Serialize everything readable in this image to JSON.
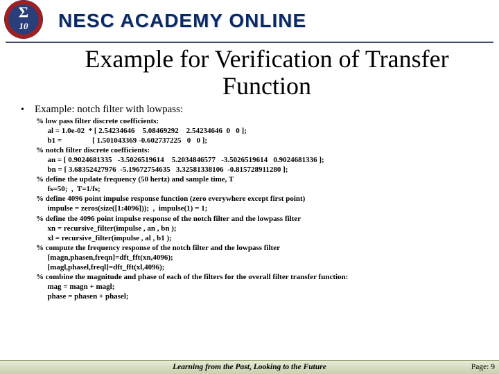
{
  "header": {
    "brand": "NESC ACADEMY ONLINE",
    "logo_sigma": "Σ",
    "logo_ten": "10"
  },
  "title": "Example for Verification of Transfer Function",
  "bullet": "•",
  "example_label": "Example:  notch filter with lowpass:",
  "code_lines": [
    "% low pass filter discrete coefficients:",
    "      al = 1.0e-02  * [ 2.54234646    5.08469292    2.54234646  0   0 ];",
    "      b1 =                [ 1.501043369 -0.602737225   0   0 ];",
    "% notch filter discrete coefficients:",
    "      an = [ 0.9024681335   -3.5026519614    5.2034846577   -3.5026519614   0.9024681336 ];",
    "      bn = [ 3.68352427976  -5.19672754635   3.32581338106  -0.815728911280 ];",
    "% define the update frequency (50 hertz) and sample time, T",
    "      fs=50;  ,  T=1/fs;",
    "% define 4096 point impulse response function (zero everywhere except first point)",
    "      impulse = zeros(size([1:4096]));  ,  impulse(1) = 1;",
    "% define the 4096 point impulse response of the notch filter and the lowpass filter",
    "      xn = recursive_filter(impulse , an , bn );",
    "      xl = recursive_filter(impulse , al , b1 );",
    "% compute the frequency response of the notch filter and the lowpass filter",
    "      [magn,phasen,freqn]=dft_fft(xn,4096);",
    "      [magl,phasel,freql]=dft_fft(xl,4096);",
    "% combine the magnitude and phase of each of the filters for the overall filter transfer function:",
    "      mag = magn + magl;",
    "      phase = phasen + phasel;"
  ],
  "footer": {
    "center": "Learning from the Past, Looking to the Future",
    "page_label": "Page: 9"
  }
}
